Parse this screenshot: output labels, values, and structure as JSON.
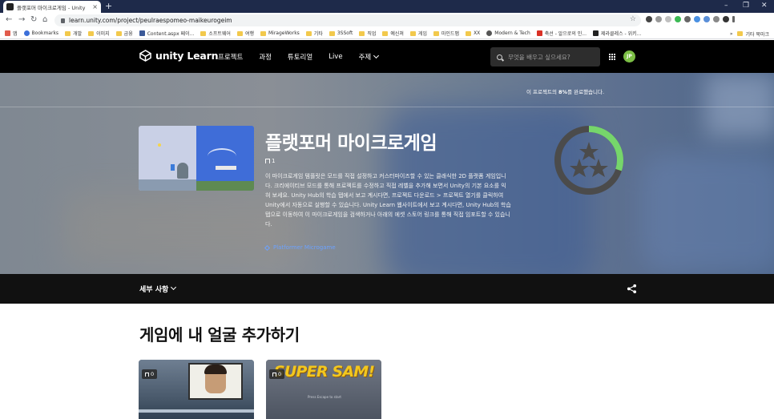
{
  "browser": {
    "tab_title": "플랫포머 마이크로게임 - Unity",
    "tab_close": "×",
    "new_tab": "+",
    "url": "learn.unity.com/project/peulraespomeo-maikeurogeim",
    "window_controls": [
      "–",
      "❐",
      "✕"
    ]
  },
  "bookmarks": {
    "items": [
      "앱",
      "Bookmarks",
      "개발",
      "이미지",
      "금융",
      "Content.aspx 페이...",
      "소프트웨어",
      "여행",
      "MirageWorks",
      "기타",
      "3SSoft",
      "직업",
      "예신쳐",
      "게임",
      "마인드맵",
      "XX",
      "Modern & Tech",
      "축선 - 알으로의 인...",
      "제라클레스 - 위키..."
    ],
    "more": "»",
    "other": "기타 북마크"
  },
  "header": {
    "logo_text": "unity Learn",
    "nav": [
      "프로젝트",
      "과정",
      "튜토리얼",
      "Live"
    ],
    "topic_label": "주제",
    "search_placeholder": "무엇을 배우고 싶으세요?",
    "avatar_initials": "JP"
  },
  "hero": {
    "progress_prefix": "이 프로젝트의 ",
    "progress_value": "8%",
    "progress_suffix": "를 완료했습니다.",
    "progress_fraction": 0.3,
    "title": "플랫포머 마이크로게임",
    "count": "1",
    "description": "이 마이크로게임 템플릿은 모드를 직접 설정하고 커스터마이즈할 수 있는 클래식한 2D 플랫폼 게임입니다. 크리에이티브 모드를 통해 프로젝트를 수정하고 직접 레벨을 추가해 보면서 Unity의 기본 요소를 익혀 보세요. Unity Hub의 학습 탭에서 보고 계시다면, 프로젝트 다운로드 > 프로젝트 열기를 클릭하여 Unity에서 자동으로 실행할 수 있습니다. Unity Learn 웹사이트에서 보고 계시다면, Unity Hub의 학습 탭으로 이동하여 이 마이크로게임을 검색하거나 아래의 에셋 스토어 링크를 통해 직접 임포트할 수 있습니다.",
    "tag": "Platformer Microgame"
  },
  "details": {
    "label": "세부 사항"
  },
  "section": {
    "title": "게임에 내 얼굴 추가하기"
  },
  "cards": [
    {
      "count": "0"
    },
    {
      "count": "0",
      "art_title": "SUPER SAM!",
      "art_sub": "Press Escape to start"
    }
  ],
  "colors": {
    "header_bg": "#000000",
    "progress_ring": "#76d66b",
    "avatar": "#7cbf45",
    "tag_link": "#6ca2ff"
  }
}
